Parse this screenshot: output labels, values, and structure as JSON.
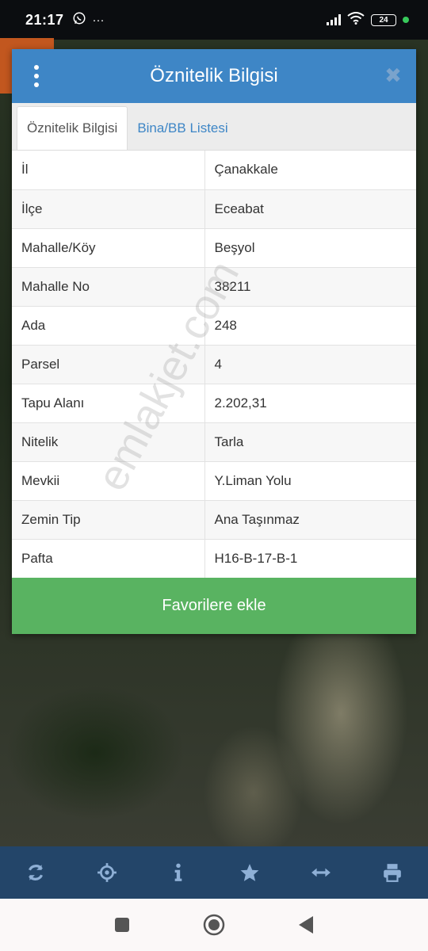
{
  "status_bar": {
    "time": "21:17",
    "app_icon": "whatsapp-icon",
    "more": "···",
    "battery": "24"
  },
  "dialog": {
    "title": "Öznitelik Bilgisi",
    "close": "✖",
    "tabs": [
      {
        "label": "Öznitelik Bilgisi",
        "active": true
      },
      {
        "label": "Bina/BB Listesi",
        "active": false
      }
    ],
    "rows": [
      {
        "key": "İl",
        "value": "Çanakkale"
      },
      {
        "key": "İlçe",
        "value": "Eceabat"
      },
      {
        "key": "Mahalle/Köy",
        "value": "Beşyol"
      },
      {
        "key": "Mahalle No",
        "value": "38211"
      },
      {
        "key": "Ada",
        "value": "248"
      },
      {
        "key": "Parsel",
        "value": "4"
      },
      {
        "key": "Tapu Alanı",
        "value": "2.202,31"
      },
      {
        "key": "Nitelik",
        "value": "Tarla"
      },
      {
        "key": "Mevkii",
        "value": "Y.Liman Yolu"
      },
      {
        "key": "Zemin Tip",
        "value": "Ana Taşınmaz"
      },
      {
        "key": "Pafta",
        "value": "H16-B-17-B-1"
      }
    ],
    "favorite_button": "Favorilere ekle"
  },
  "watermark": "emlakjet.com",
  "toolbar": {
    "icons": [
      "refresh-icon",
      "locate-icon",
      "info-icon",
      "star-icon",
      "measure-icon",
      "print-icon"
    ]
  },
  "nav": {
    "icons": [
      "recents-icon",
      "home-icon",
      "back-icon"
    ]
  },
  "colors": {
    "header": "#3e86c6",
    "favorite": "#59b361",
    "toolbar": "#234569"
  }
}
